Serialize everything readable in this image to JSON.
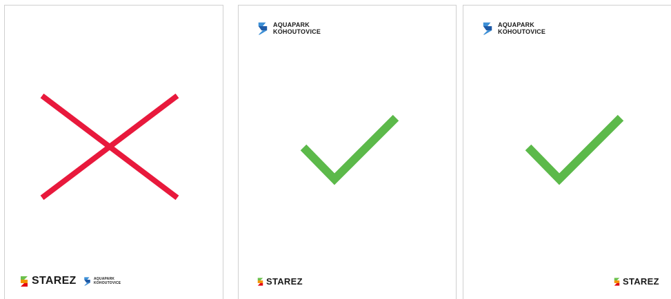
{
  "cards": [
    {
      "verdict": "incorrect",
      "mark": "cross-icon",
      "footer_logos": [
        {
          "name": "STAREZ"
        },
        {
          "line1": "AQUAPARK",
          "line2": "KOHOUTOVICE"
        }
      ]
    },
    {
      "verdict": "correct",
      "mark": "check-icon",
      "header_logo": {
        "line1": "AQUAPARK",
        "line2": "KOHOUTOVICE"
      },
      "footer_logo": {
        "name": "STAREZ"
      }
    },
    {
      "verdict": "correct",
      "mark": "check-icon",
      "header_logo": {
        "line1": "AQUAPARK",
        "line2": "KOHOUTOVICE"
      },
      "footer_logo": {
        "name": "STAREZ"
      }
    }
  ],
  "colors": {
    "cross": "#e8193c",
    "check": "#5cb94a",
    "aquapark_blue_dark": "#1f5aa6",
    "aquapark_blue_light": "#3c8fd6",
    "starez_green": "#6cc04a",
    "starez_orange": "#f39200",
    "starez_red": "#e30613",
    "card_border": "#cfcfcf"
  }
}
